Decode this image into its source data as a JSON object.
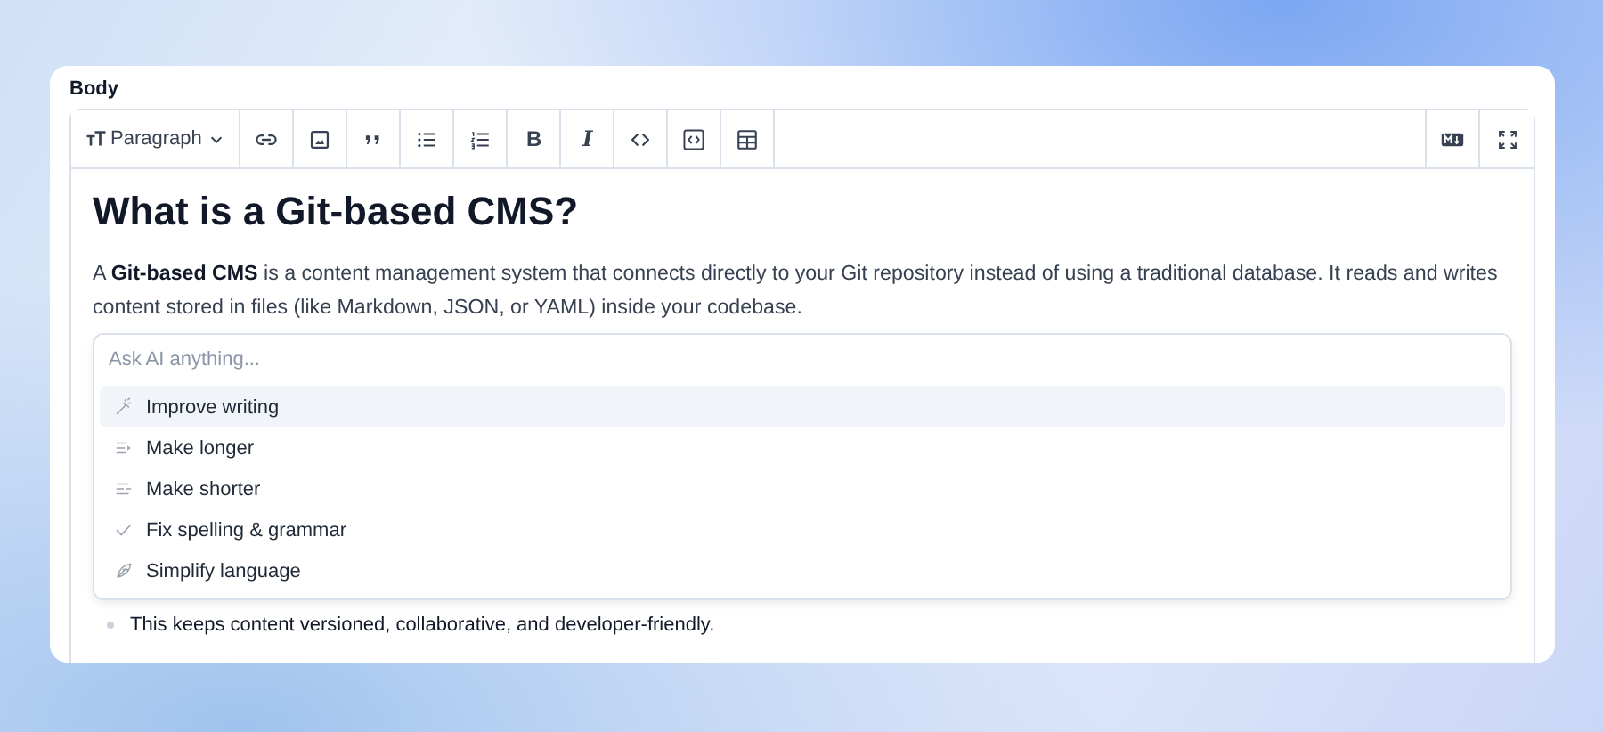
{
  "field": {
    "label": "Body"
  },
  "toolbar": {
    "block_format": {
      "label": "Paragraph"
    },
    "buttons": [
      {
        "kind": "link"
      },
      {
        "kind": "image"
      },
      {
        "kind": "quote"
      },
      {
        "kind": "bullet-list"
      },
      {
        "kind": "numbered-list"
      },
      {
        "kind": "bold",
        "label": "B"
      },
      {
        "kind": "italic",
        "label": "I"
      },
      {
        "kind": "code"
      },
      {
        "kind": "code-block"
      },
      {
        "kind": "table"
      }
    ],
    "right_buttons": [
      {
        "kind": "markdown"
      },
      {
        "kind": "fullscreen"
      }
    ]
  },
  "content": {
    "heading": "What is a Git-based CMS?",
    "paragraph": "A **Git-based CMS** is a content management system that connects directly to your Git repository instead of using a traditional database. It reads and writes content stored in files (like Markdown, JSON, or YAML) inside your codebase.",
    "bullets": [
      "This keeps content versioned, collaborative, and developer-friendly."
    ]
  },
  "ai_menu": {
    "placeholder": "Ask AI anything...",
    "items": [
      {
        "label": "Improve writing",
        "kind": "wand",
        "selected": true
      },
      {
        "label": "Make longer",
        "kind": "lengthen",
        "selected": false
      },
      {
        "label": "Make shorter",
        "kind": "shorten",
        "selected": false
      },
      {
        "label": "Fix spelling & grammar",
        "kind": "check",
        "selected": false
      },
      {
        "label": "Simplify language",
        "kind": "feather",
        "selected": false
      }
    ]
  }
}
